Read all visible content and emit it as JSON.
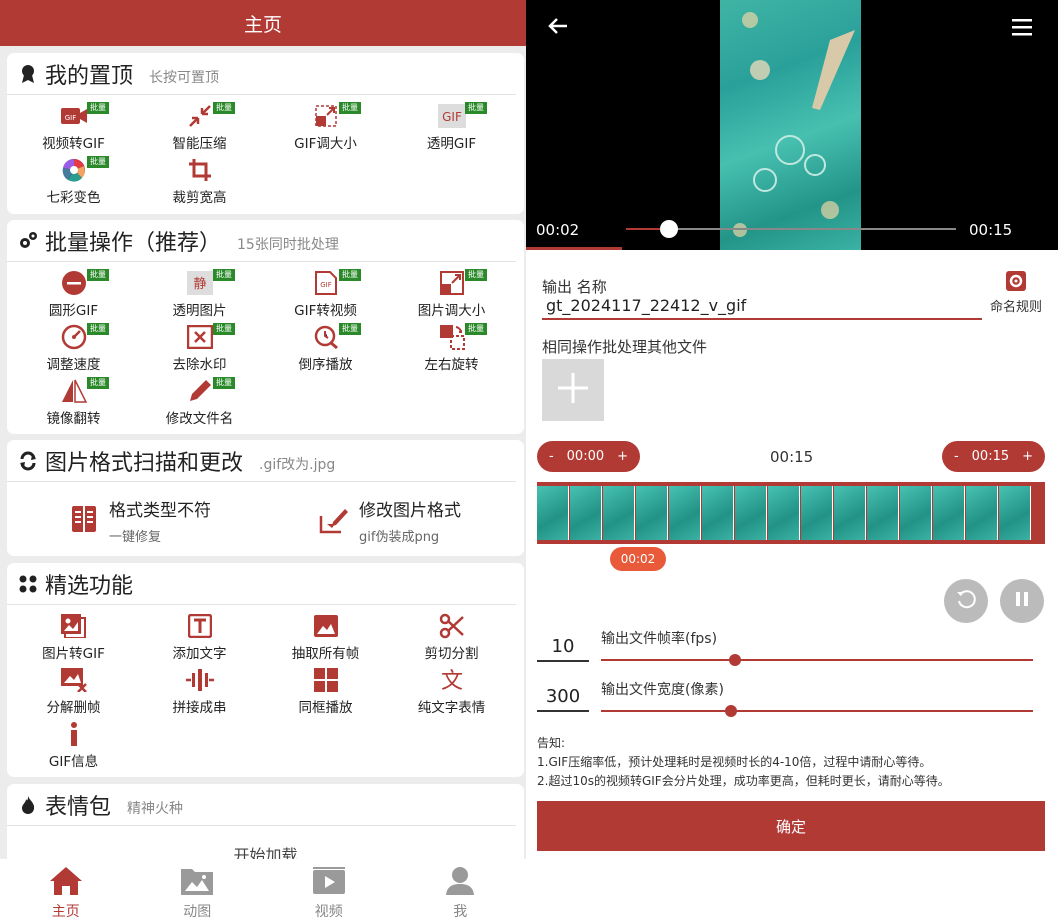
{
  "left": {
    "header_title": "主页",
    "badge_text": "批量",
    "pinned": {
      "title": "我的置顶",
      "subtitle": "长按可置顶",
      "items": [
        "视频转GIF",
        "智能压缩",
        "GIF调大小",
        "透明GIF",
        "七彩变色",
        "裁剪宽高"
      ]
    },
    "batch": {
      "title": "批量操作（推荐）",
      "subtitle": "15张同时批处理",
      "items": [
        "圆形GIF",
        "透明图片",
        "GIF转视频",
        "图片调大小",
        "调整速度",
        "去除水印",
        "倒序播放",
        "左右旋转",
        "镜像翻转",
        "修改文件名"
      ]
    },
    "format": {
      "title": "图片格式扫描和更改",
      "subtitle": ".gif改为.jpg",
      "left_title": "格式类型不符",
      "left_sub": "一键修复",
      "right_title": "修改图片格式",
      "right_sub": "gif伪装成png"
    },
    "featured": {
      "title": "精选功能",
      "items": [
        "图片转GIF",
        "添加文字",
        "抽取所有帧",
        "剪切分割",
        "分解删帧",
        "拼接成串",
        "同框播放",
        "纯文字表情",
        "GIF信息"
      ]
    },
    "emoji": {
      "title": "表情包",
      "subtitle": "精神火种",
      "loading": "开始加载"
    },
    "tabs": [
      "主页",
      "动图",
      "视频",
      "我"
    ],
    "icon_colors": {
      "accent": "#b23a35",
      "badge": "#2a8a2a",
      "tab_inactive": "#9a9a9a"
    }
  },
  "right": {
    "video": {
      "current_time": "00:02",
      "total_time": "00:15",
      "progress_fraction": 0.13
    },
    "output_name_label": "输出 名称",
    "output_name_value": "gt_2024117_22412_v_gif",
    "naming_rule_label": "命名规则",
    "batch_other_label": "相同操作批处理其他文件",
    "trim": {
      "start_minus": "-",
      "start_time": "00:00",
      "start_plus": "+",
      "duration": "00:15",
      "end_minus": "-",
      "end_time": "00:15",
      "end_plus": "+",
      "marker_time": "00:02"
    },
    "fps": {
      "value": "10",
      "label": "输出文件帧率(fps)",
      "slider_fraction": 0.31
    },
    "width": {
      "value": "300",
      "label": "输出文件宽度(像素)",
      "slider_fraction": 0.3
    },
    "notice_title": "告知:",
    "notice_1": "1.GIF压缩率低，预计处理耗时是视频时长的4-10倍，过程中请耐心等待。",
    "notice_2": "2.超过10s的视频转GIF会分片处理，成功率更高，但耗时更长，请耐心等待。",
    "confirm_label": "确定"
  }
}
